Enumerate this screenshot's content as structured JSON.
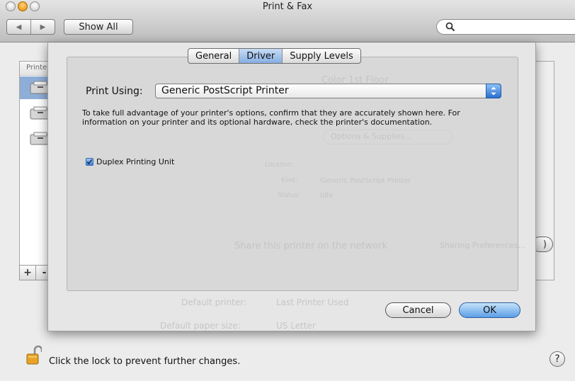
{
  "window": {
    "title": "Print & Fax"
  },
  "toolbar": {
    "back_icon": "left-arrow-icon",
    "forward_icon": "right-arrow-icon",
    "show_all_label": "Show All",
    "search_placeholder": ""
  },
  "background": {
    "printers_header": "Printers",
    "printer_selected_name": "Color 1st Floor",
    "options_button": "Options & Supplies...",
    "location_label": "Location:",
    "kind_label": "Kind:",
    "kind_value": "Generic PostScript Printer",
    "status_label": "Status:",
    "status_value": "Idle",
    "share_label": "Share this printer on the network",
    "sharing_prefs_button": "Sharing Preferences...",
    "default_printer_label": "Default printer:",
    "default_printer_value": "Last Printer Used",
    "default_paper_label": "Default paper size:",
    "default_paper_value": "US Letter",
    "add_label": "+",
    "remove_label": "-"
  },
  "sheet": {
    "tabs": [
      {
        "label": "General",
        "active": false
      },
      {
        "label": "Driver",
        "active": true
      },
      {
        "label": "Supply Levels",
        "active": false
      }
    ],
    "print_using_label": "Print Using:",
    "print_using_value": "Generic PostScript Printer",
    "info_text": "To take full advantage of your printer's options, confirm that they are accurately shown here. For information on your printer and its optional hardware, check the printer's documentation.",
    "duplex_label": "Duplex Printing Unit",
    "duplex_checked": true,
    "cancel_label": "Cancel",
    "ok_label": "OK"
  },
  "footer": {
    "lock_text": "Click the lock to prevent further changes.",
    "help_label": "?"
  },
  "colors": {
    "accent": "#5b9ee6",
    "selection": "#8eaed8"
  }
}
